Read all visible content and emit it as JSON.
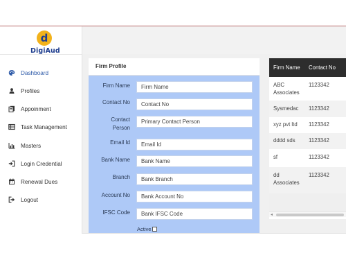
{
  "brand": {
    "logo_letter": "d",
    "name": "DigiAud"
  },
  "sidebar": {
    "items": [
      {
        "label": "Dashboard",
        "icon": "palette-icon",
        "active": true
      },
      {
        "label": "Profiles",
        "icon": "user-icon"
      },
      {
        "label": "Appoinment",
        "icon": "document-icon"
      },
      {
        "label": "Task Management",
        "icon": "table-icon"
      },
      {
        "label": "Masters",
        "icon": "bar-chart-icon"
      },
      {
        "label": "Login Credential",
        "icon": "sign-in-icon"
      },
      {
        "label": "Renewal Dues",
        "icon": "calendar-icon"
      },
      {
        "label": "Logout",
        "icon": "sign-out-icon"
      }
    ]
  },
  "firm_profile": {
    "title": "Firm Profile",
    "fields": [
      {
        "label": "Firm Name",
        "placeholder": "Firm Name"
      },
      {
        "label": "Contact No",
        "placeholder": "Contact No"
      },
      {
        "label": "Contact Person",
        "placeholder": "Primary Contact Person"
      },
      {
        "label": "Email Id",
        "placeholder": "Email Id"
      },
      {
        "label": "Bank Name",
        "placeholder": "Bank Name"
      },
      {
        "label": "Branch",
        "placeholder": "Bank Branch"
      },
      {
        "label": "Account No",
        "placeholder": "Bank Account No"
      },
      {
        "label": "IFSC Code",
        "placeholder": "Bank IFSC Code"
      }
    ],
    "active_label": "Active"
  },
  "firm_table": {
    "headers": [
      "Firm Name",
      "Contact No"
    ],
    "rows": [
      [
        "ABC Associates",
        "1123342"
      ],
      [
        "Sysmedac",
        "1123342"
      ],
      [
        "xyz pvt ltd",
        "1123342"
      ],
      [
        "dddd sds",
        "1123342"
      ],
      [
        "sf",
        "1123342"
      ],
      [
        "dd Associates",
        "1123342"
      ]
    ]
  },
  "colors": {
    "form_bg": "#aec9f7",
    "table_header": "#2d2d2d",
    "brand_blue": "#1f3e8f",
    "brand_yellow": "#f2b21b",
    "accent": "#2e5aa8"
  }
}
